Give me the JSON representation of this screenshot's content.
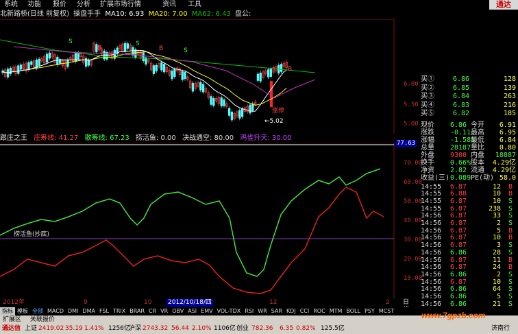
{
  "menu": {
    "items": [
      "系统",
      "功能",
      "报价",
      "分析",
      "扩展市场行情",
      "资讯",
      "工具"
    ],
    "brand": "通达"
  },
  "kline": {
    "title": "北新路桥(日线 前复权)",
    "indicator_name": "操盘手手",
    "ma10": "MA10: 6.93",
    "ma20": "MA20: 7.00",
    "ma62": "MA62: 6.43",
    "extra": "盘公:",
    "low_label": "←5.02",
    "limit_label": "涨停",
    "y_ticks": [
      "6.00",
      "5.50",
      "5.00"
    ],
    "colors": {
      "up": "#ff4040",
      "down": "#54fcfc",
      "ma10": "#ffffff",
      "ma20": "#ffff00",
      "ma62": "#00c000",
      "ma_extra": "#c030c0"
    }
  },
  "indicator": {
    "title": "跟庄之王",
    "line1": "庄筹线: 41.27",
    "line2": "散筹线: 67.23",
    "line3": "捞活鱼: 0.00",
    "line4": "决战遇空: 80.00",
    "line5": "鸡雀升天: 30.00",
    "level_label": "捞活鱼(抄底)",
    "current": "77.63",
    "y_ticks": [
      "70.00",
      "60.00",
      "50.00",
      "40.00",
      "30.00",
      "20.00",
      "10.00"
    ]
  },
  "quote": {
    "asks": [
      {
        "label": "买①",
        "price": "6.86",
        "vol": "128"
      },
      {
        "label": "买②",
        "price": "6.85",
        "vol": "139"
      },
      {
        "label": "买③",
        "price": "6.84",
        "vol": "263"
      },
      {
        "label": "买④",
        "price": "6.83",
        "vol": "216"
      },
      {
        "label": "买⑤",
        "price": "6.82",
        "vol": "185"
      }
    ],
    "stats": [
      {
        "l1": "现价",
        "v1": "6.86",
        "l2": "今开",
        "v2": "6.91"
      },
      {
        "l1": "涨跌",
        "v1": "-0.11",
        "l2": "最高",
        "v2": "6.95"
      },
      {
        "l1": "涨幅",
        "v1": "-1.58%",
        "l2": "最低",
        "v2": "6.84"
      },
      {
        "l1": "总量",
        "v1": "28187",
        "l2": "量比",
        "v2": "0.80"
      },
      {
        "l1": "外盘",
        "v1": "9300",
        "l2": "内盘",
        "v2": "18887"
      },
      {
        "l1": "换手",
        "v1": "0.66%",
        "l2": "股本",
        "v2": "4.29亿"
      },
      {
        "l1": "净资",
        "v1": "2.82",
        "l2": "流通",
        "v2": "4.29亿"
      },
      {
        "l1": "收益(三)",
        "v1": "0.089",
        "l2": "PE(动)",
        "v2": "58.0"
      }
    ],
    "ticks": [
      {
        "time": "14:55",
        "price": "6.87",
        "vol": "12",
        "side": "B"
      },
      {
        "time": "14:55",
        "price": "6.88",
        "vol": "10",
        "side": "B"
      },
      {
        "time": "14:55",
        "price": "6.87",
        "vol": "10",
        "side": "S"
      },
      {
        "time": "14:55",
        "price": "6.87",
        "vol": "238",
        "side": "S"
      },
      {
        "time": "14:56",
        "price": "6.87",
        "vol": "33",
        "side": "S"
      },
      {
        "time": "14:56",
        "price": "6.87",
        "vol": "2",
        "side": "S"
      },
      {
        "time": "14:56",
        "price": "6.87",
        "vol": "5",
        "side": "B"
      },
      {
        "time": "14:56",
        "price": "6.87",
        "vol": "10",
        "side": "B"
      },
      {
        "time": "14:56",
        "price": "6.87",
        "vol": "3",
        "side": "S"
      },
      {
        "time": "14:56",
        "price": "6.86",
        "vol": "28",
        "side": "S"
      },
      {
        "time": "14:56",
        "price": "6.87",
        "vol": "11",
        "side": "B"
      },
      {
        "time": "14:56",
        "price": "6.87",
        "vol": "24",
        "side": "B"
      },
      {
        "time": "14:56",
        "price": "6.86",
        "vol": "2",
        "side": "S"
      },
      {
        "time": "14:56",
        "price": "6.87",
        "vol": "10",
        "side": "S"
      },
      {
        "time": "14:56",
        "price": "6.86",
        "vol": "64",
        "side": "S"
      },
      {
        "time": "14:56",
        "price": "6.86",
        "vol": "5",
        "side": "S"
      },
      {
        "time": "14:56",
        "price": "6.86",
        "vol": "21",
        "side": "S"
      },
      {
        "time": "14:56",
        "price": "6.86",
        "vol": "102",
        "side": "S"
      },
      {
        "time": "14:59",
        "price": "6.86",
        "vol": "24",
        "side": "S"
      },
      {
        "time": "14:59",
        "price": "6.86",
        "vol": "27",
        "side": "S"
      },
      {
        "time": "14:59",
        "price": "6.86",
        "vol": "23",
        "side": "S"
      }
    ]
  },
  "datebar": {
    "labels": [
      "2012年",
      "9",
      "10",
      "2012/10/18/四",
      "12",
      "2"
    ],
    "right": "日线"
  },
  "tabs": [
    "指标",
    "模板",
    "全部",
    "MACD",
    "DMI",
    "DMA",
    "FSL",
    "TRIX",
    "BRAR",
    "CR",
    "VR",
    "OBV",
    "ASI",
    "EMV",
    "VOL-TDX",
    "RSI",
    "WR",
    "SAR",
    "KDJ",
    "CCI",
    "ROC",
    "MTM",
    "BOLL",
    "PSY",
    "MCST"
  ],
  "extbar": [
    "扩展区",
    "关联报价"
  ],
  "status": {
    "brand": "通达信",
    "sh_label": "上证",
    "sh_value": "2419.02",
    "sh_change": "35.19",
    "sh_pct": "1.41%",
    "sh_amount": "1256亿",
    "hs_label": "沪深",
    "hs_value": "2743.32",
    "hs_change": "56.44",
    "hs_pct": "2.10%",
    "hs_amount": "1106亿",
    "cy_label": "创业",
    "cy_value": "782.36",
    "cy_change": "6.35",
    "cy_pct": "0.82%",
    "cy_amount": "125.5亿",
    "region": "济南行"
  },
  "watermark": "www.7gpzb.com"
}
